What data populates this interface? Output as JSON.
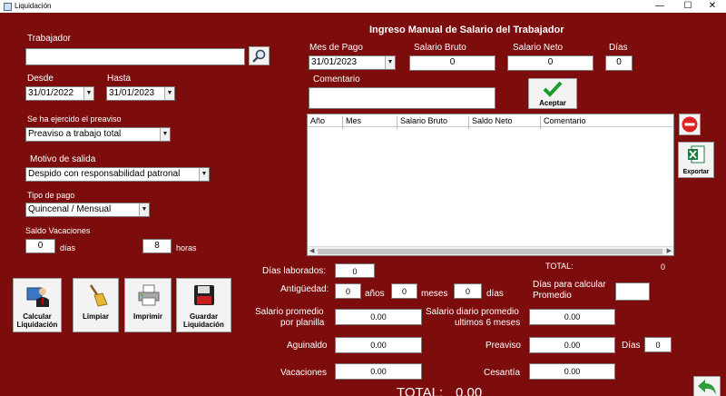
{
  "window": {
    "title": "Liquidación",
    "min_icon": "—",
    "max_icon": "☐",
    "close_icon": "✕"
  },
  "left": {
    "trabajador_label": "Trabajador",
    "trabajador_value": "",
    "desde_label": "Desde",
    "desde_value": "31/01/2022",
    "hasta_label": "Hasta",
    "hasta_value": "31/01/2023",
    "preaviso_label": "Se ha ejercido el preaviso",
    "preaviso_value": "Preaviso a trabajo total",
    "motivo_label": "Motivo de salida",
    "motivo_value": "Despido con responsabilidad patronal",
    "tipo_pago_label": "Tipo de pago",
    "tipo_pago_value": "Quincenal / Mensual",
    "saldo_label": "Saldo Vacaciones",
    "dias_value": "0",
    "dias_label": "días",
    "horas_value": "8",
    "horas_label": "horas"
  },
  "buttons": {
    "calcular": "Calcular Liquidación",
    "limpiar": "Limpiar",
    "imprimir": "Imprimir",
    "guardar": "Guardar Liquidación"
  },
  "manual": {
    "title": "Ingreso Manual de Salario del Trabajador",
    "mes_label": "Mes de Pago",
    "mes_value": "31/01/2023",
    "bruto_label": "Salario Bruto",
    "bruto_value": "0",
    "neto_label": "Salario Neto",
    "neto_value": "0",
    "dias_label": "Días",
    "dias_value": "0",
    "comentario_label": "Comentario",
    "comentario_value": "",
    "aceptar": "Aceptar",
    "exportar": "Exportar",
    "columns": [
      "Año",
      "Mes",
      "Salario Bruto",
      "Saldo Neto",
      "Comentario"
    ],
    "total_label": "TOTAL:",
    "total_value": "0"
  },
  "summary": {
    "dias_laborados_label": "Días laborados:",
    "dias_laborados_value": "0",
    "antiguedad_label": "Antigüedad:",
    "anos_value": "0",
    "anos_label": "años",
    "meses_value": "0",
    "meses_label": "meses",
    "ant_dias_value": "0",
    "ant_dias_label": "días",
    "dias_calcular_label_1": "Días para calcular",
    "dias_calcular_label_2": "Promedio",
    "dias_calcular_value": "",
    "salario_promedio_label_1": "Salario promedio",
    "salario_promedio_label_2": "por planilla",
    "salario_promedio_value": "0.00",
    "salario_diario_label_1": "Salario diario promedio",
    "salario_diario_label_2": "ultimos 6 meses",
    "salario_diario_value": "0.00",
    "aguinaldo_label": "Aguinaldo",
    "aguinaldo_value": "0.00",
    "preaviso_label": "Preaviso",
    "preaviso_value": "0.00",
    "preaviso_dias_label": "Días",
    "preaviso_dias_value": "0",
    "vacaciones_label": "Vacaciones",
    "vacaciones_value": "0.00",
    "cesantia_label": "Cesantía",
    "cesantia_value": "0.00",
    "total_label": "TOTAL:",
    "total_value": "0.00"
  }
}
